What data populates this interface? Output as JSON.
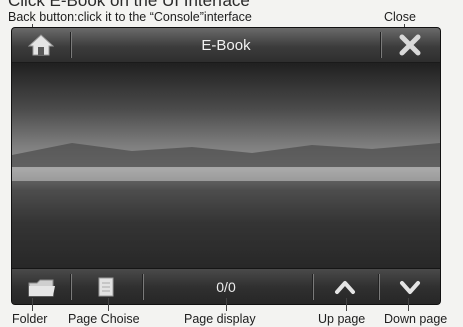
{
  "header_text": "Click E-Book on the UI Interface",
  "annotations": {
    "back": "Back button:click it to the “Console”interface",
    "close": "Close",
    "folder": "Folder",
    "page_choise": "Page Choise",
    "page_display": "Page display",
    "up_page": "Up page",
    "down_page": "Down page"
  },
  "device": {
    "title": "E-Book",
    "page_display": "0/0",
    "icons": {
      "back": "home-icon",
      "close": "close-icon",
      "folder": "folder-icon",
      "page_choise": "page-icon",
      "up": "chevron-up-icon",
      "down": "chevron-down-icon"
    }
  }
}
